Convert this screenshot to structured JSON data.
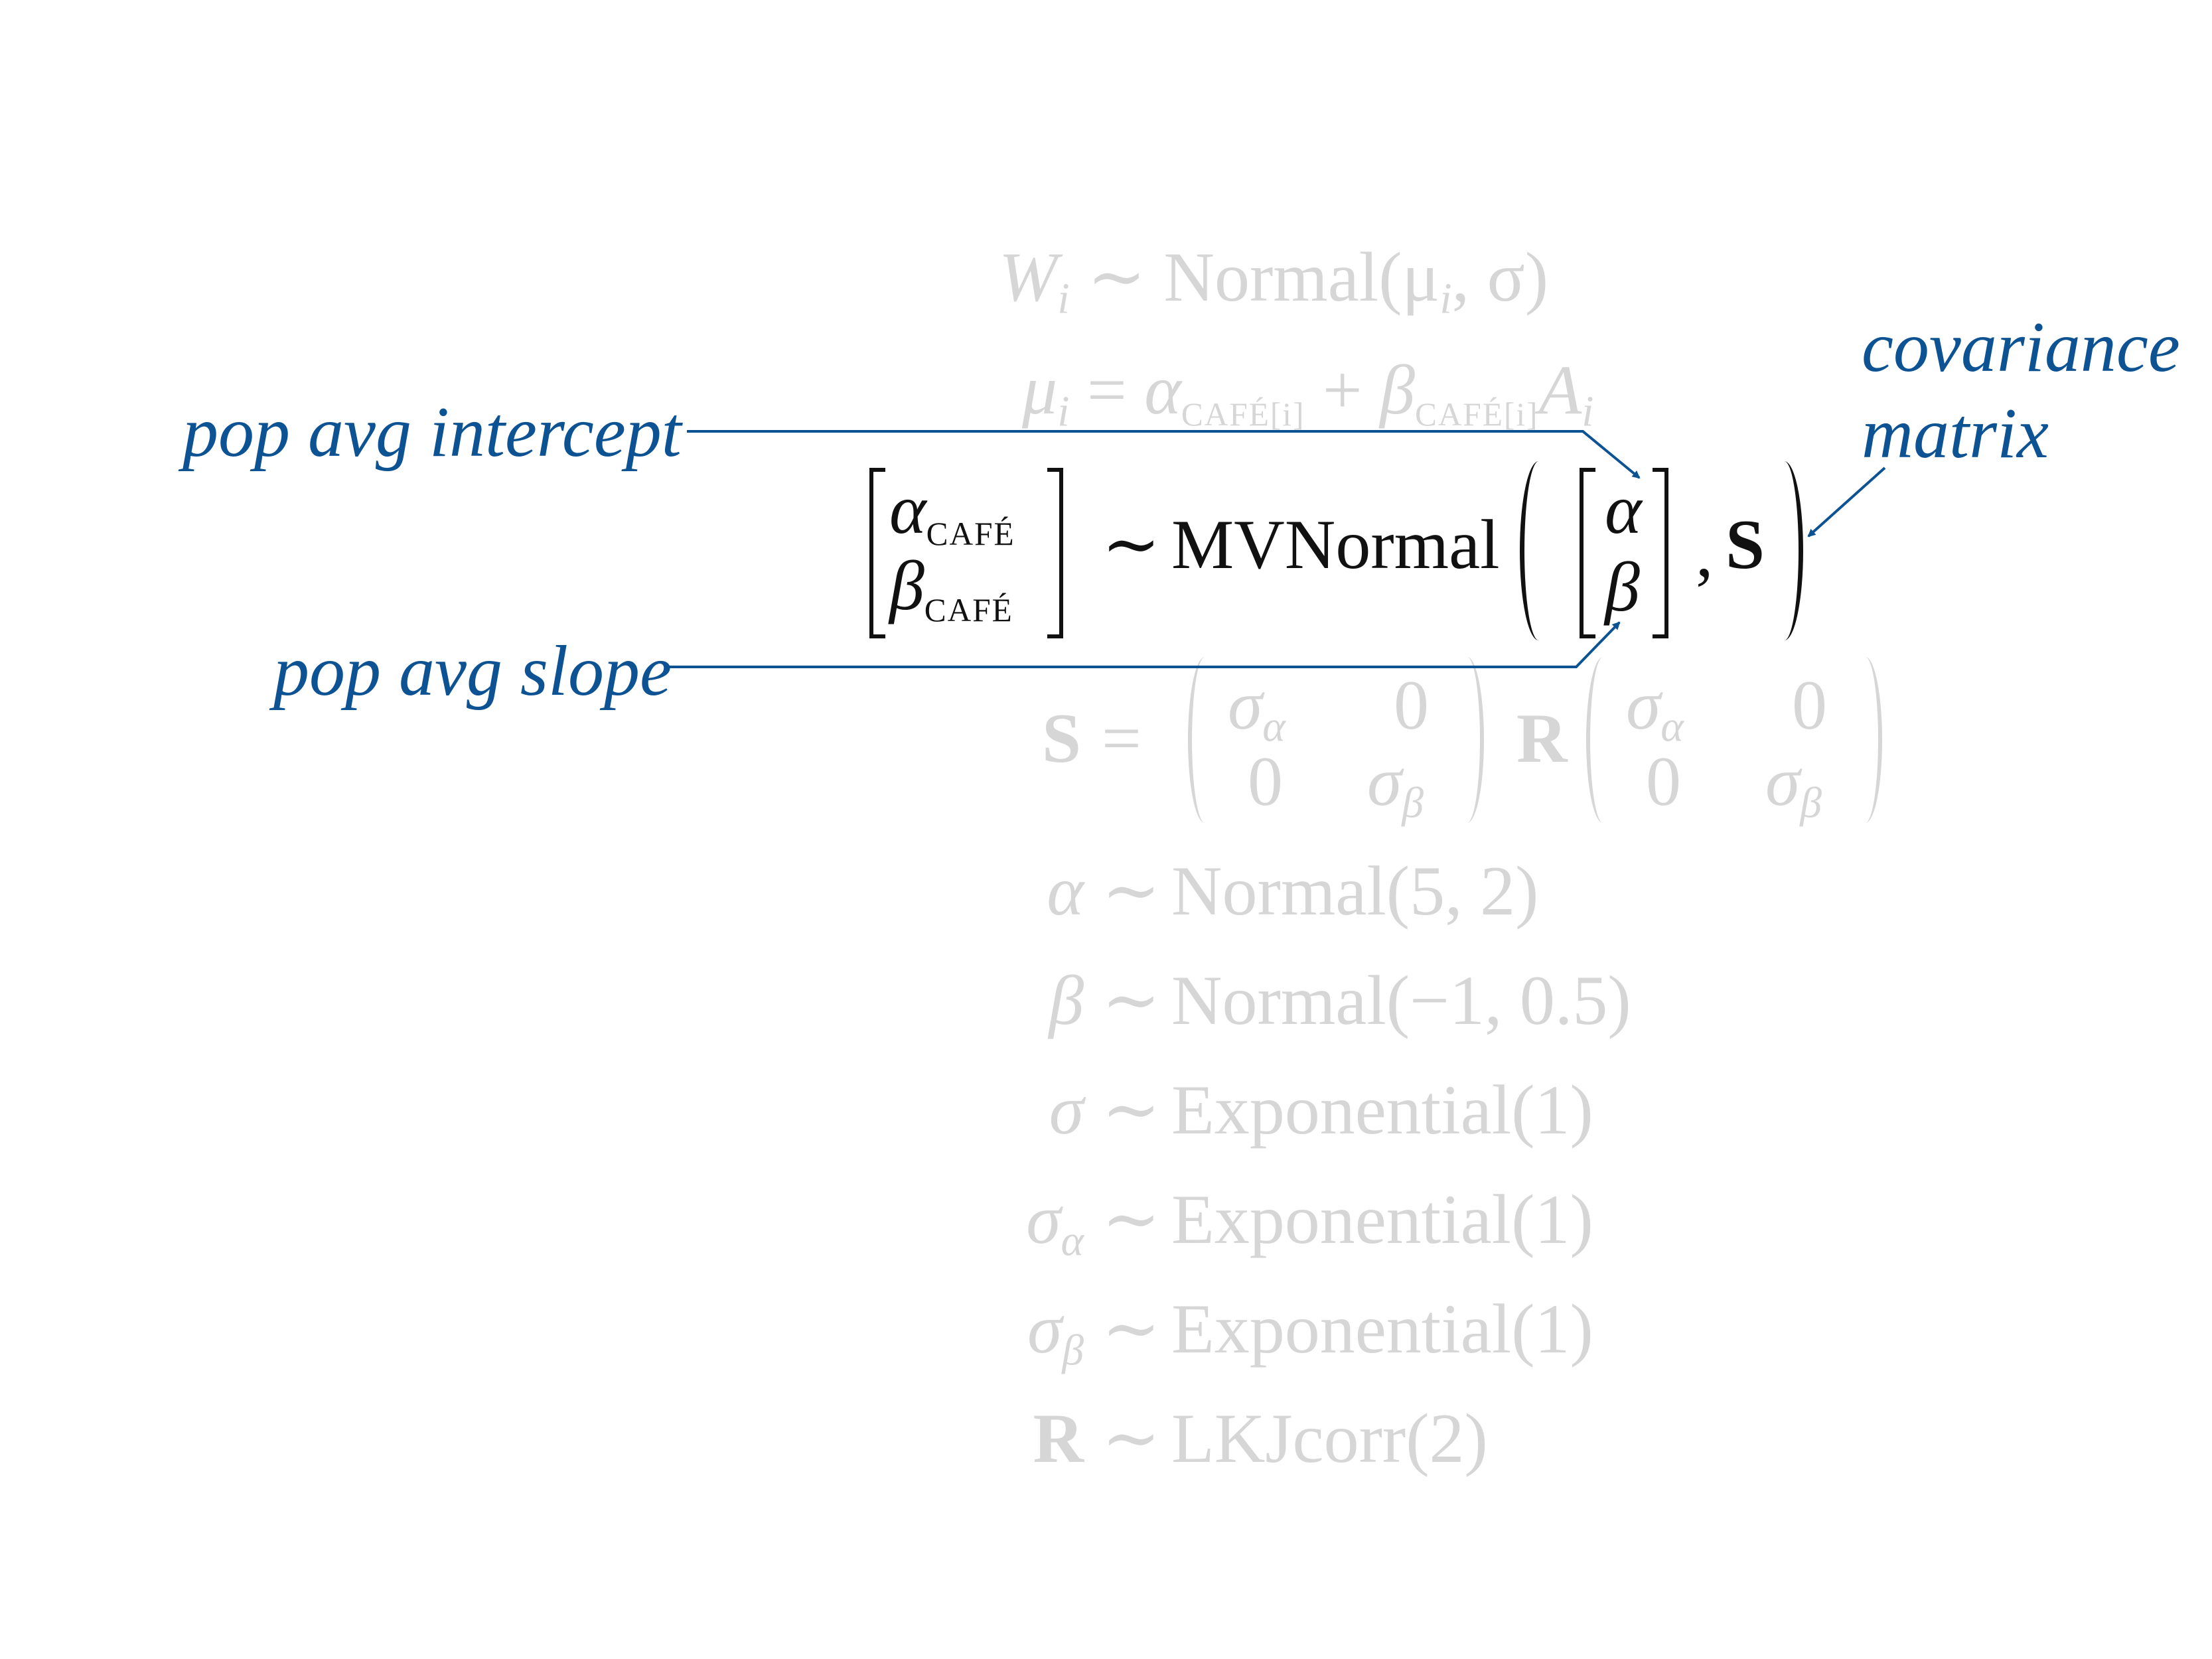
{
  "colors": {
    "active_text": "#111111",
    "faded_text": "#d6d6d6",
    "annotation": "#0d5292"
  },
  "equations": {
    "likelihood": {
      "lhs": "W",
      "lhs_sub": "i",
      "op": "∼",
      "rhs": "Normal(μ",
      "rhs_sub": "i",
      "rhs_tail": ", σ)"
    },
    "linear_model": {
      "lhs": "μ",
      "lhs_sub": "i",
      "op": "=",
      "a": "α",
      "a_sub": "CAFÉ[i]",
      "plus": "+",
      "b": "β",
      "b_sub": "CAFÉ[i]",
      "c": "A",
      "c_sub": "i"
    },
    "mvn": {
      "lhs_top": "α",
      "lhs_top_sub": "CAFÉ",
      "lhs_bottom": "β",
      "lhs_bottom_sub": "CAFÉ",
      "op": "∼",
      "dist": "MVNormal",
      "mean_top": "α",
      "mean_bottom": "β",
      "comma": ",",
      "cov": "S"
    },
    "cov_def": {
      "lhs": "S",
      "op": "=",
      "m1": [
        "σ",
        "α",
        "0",
        "0",
        "σ",
        "β"
      ],
      "mid": "R",
      "m2": [
        "σ",
        "α",
        "0",
        "0",
        "σ",
        "β"
      ]
    },
    "priors": [
      {
        "lhs": "α",
        "lhs_sub": "",
        "op": "∼",
        "rhs": "Normal(5, 2)",
        "bold": false
      },
      {
        "lhs": "β",
        "lhs_sub": "",
        "op": "∼",
        "rhs": "Normal(−1, 0.5)",
        "bold": false
      },
      {
        "lhs": "σ",
        "lhs_sub": "",
        "op": "∼",
        "rhs": "Exponential(1)",
        "bold": false
      },
      {
        "lhs": "σ",
        "lhs_sub": "α",
        "op": "∼",
        "rhs": "Exponential(1)",
        "bold": false
      },
      {
        "lhs": "σ",
        "lhs_sub": "β",
        "op": "∼",
        "rhs": "Exponential(1)",
        "bold": false
      },
      {
        "lhs": "R",
        "lhs_sub": "",
        "op": "∼",
        "rhs": "LKJcorr(2)",
        "bold": true
      }
    ]
  },
  "annotations": {
    "intercept": "pop avg intercept",
    "slope": "pop avg slope",
    "covariance_line1": "covariance",
    "covariance_line2": "matrix"
  }
}
